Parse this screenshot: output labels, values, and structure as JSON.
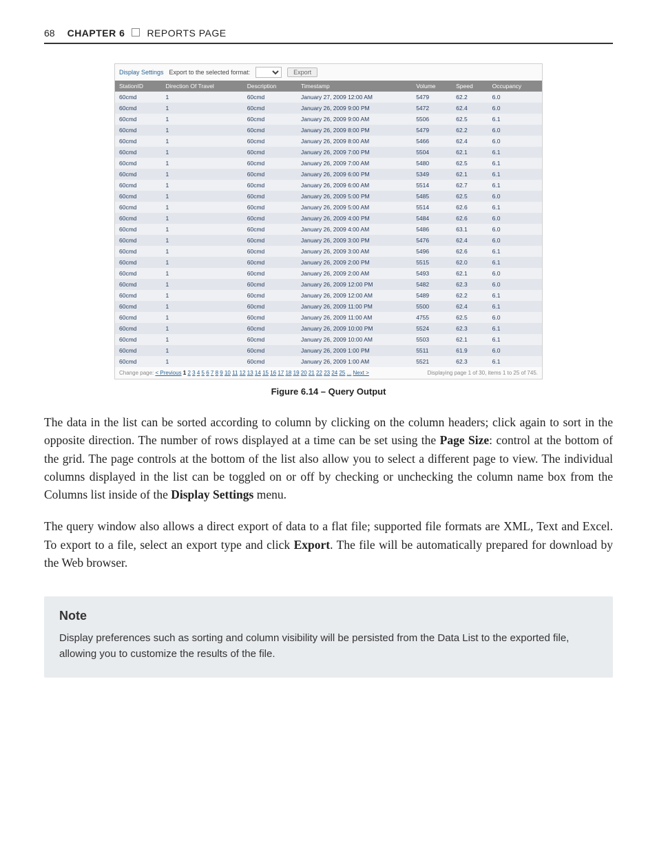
{
  "header": {
    "page_number": "68",
    "chapter_label": "CHAPTER 6",
    "chapter_title": "REPORTS PAGE"
  },
  "figure": {
    "toolbar": {
      "display_settings": "Display Settings",
      "export_label": "Export to the selected format:",
      "export_selected": " ",
      "export_button": "Export"
    },
    "columns": [
      "StationID",
      "Direction Of Travel",
      "Description",
      "Timestamp",
      "Volume",
      "Speed",
      "Occupancy"
    ],
    "rows": [
      [
        "60cmd",
        "1",
        "60cmd",
        "January 27, 2009 12:00 AM",
        "5479",
        "62.2",
        "6.0"
      ],
      [
        "60cmd",
        "1",
        "60cmd",
        "January 26, 2009 9:00 PM",
        "5472",
        "62.4",
        "6.0"
      ],
      [
        "60cmd",
        "1",
        "60cmd",
        "January 26, 2009 9:00 AM",
        "5506",
        "62.5",
        "6.1"
      ],
      [
        "60cmd",
        "1",
        "60cmd",
        "January 26, 2009 8:00 PM",
        "5479",
        "62.2",
        "6.0"
      ],
      [
        "60cmd",
        "1",
        "60cmd",
        "January 26, 2009 8:00 AM",
        "5466",
        "62.4",
        "6.0"
      ],
      [
        "60cmd",
        "1",
        "60cmd",
        "January 26, 2009 7:00 PM",
        "5504",
        "62.1",
        "6.1"
      ],
      [
        "60cmd",
        "1",
        "60cmd",
        "January 26, 2009 7:00 AM",
        "5480",
        "62.5",
        "6.1"
      ],
      [
        "60cmd",
        "1",
        "60cmd",
        "January 26, 2009 6:00 PM",
        "5349",
        "62.1",
        "6.1"
      ],
      [
        "60cmd",
        "1",
        "60cmd",
        "January 26, 2009 6:00 AM",
        "5514",
        "62.7",
        "6.1"
      ],
      [
        "60cmd",
        "1",
        "60cmd",
        "January 26, 2009 5:00 PM",
        "5485",
        "62.5",
        "6.0"
      ],
      [
        "60cmd",
        "1",
        "60cmd",
        "January 26, 2009 5:00 AM",
        "5514",
        "62.6",
        "6.1"
      ],
      [
        "60cmd",
        "1",
        "60cmd",
        "January 26, 2009 4:00 PM",
        "5484",
        "62.6",
        "6.0"
      ],
      [
        "60cmd",
        "1",
        "60cmd",
        "January 26, 2009 4:00 AM",
        "5486",
        "63.1",
        "6.0"
      ],
      [
        "60cmd",
        "1",
        "60cmd",
        "January 26, 2009 3:00 PM",
        "5476",
        "62.4",
        "6.0"
      ],
      [
        "60cmd",
        "1",
        "60cmd",
        "January 26, 2009 3:00 AM",
        "5496",
        "62.6",
        "6.1"
      ],
      [
        "60cmd",
        "1",
        "60cmd",
        "January 26, 2009 2:00 PM",
        "5515",
        "62.0",
        "6.1"
      ],
      [
        "60cmd",
        "1",
        "60cmd",
        "January 26, 2009 2:00 AM",
        "5493",
        "62.1",
        "6.0"
      ],
      [
        "60cmd",
        "1",
        "60cmd",
        "January 26, 2009 12:00 PM",
        "5482",
        "62.3",
        "6.0"
      ],
      [
        "60cmd",
        "1",
        "60cmd",
        "January 26, 2009 12:00 AM",
        "5489",
        "62.2",
        "6.1"
      ],
      [
        "60cmd",
        "1",
        "60cmd",
        "January 26, 2009 11:00 PM",
        "5500",
        "62.4",
        "6.1"
      ],
      [
        "60cmd",
        "1",
        "60cmd",
        "January 26, 2009 11:00 AM",
        "4755",
        "62.5",
        "6.0"
      ],
      [
        "60cmd",
        "1",
        "60cmd",
        "January 26, 2009 10:00 PM",
        "5524",
        "62.3",
        "6.1"
      ],
      [
        "60cmd",
        "1",
        "60cmd",
        "January 26, 2009 10:00 AM",
        "5503",
        "62.1",
        "6.1"
      ],
      [
        "60cmd",
        "1",
        "60cmd",
        "January 26, 2009 1:00 PM",
        "5511",
        "61.9",
        "6.0"
      ],
      [
        "60cmd",
        "1",
        "60cmd",
        "January 26, 2009 1:00 AM",
        "5521",
        "62.3",
        "6.1"
      ]
    ],
    "footer": {
      "change_page_label": "Change page:",
      "prev": "< Previous",
      "pages": [
        "1",
        "2",
        "3",
        "4",
        "5",
        "6",
        "7",
        "8",
        "9",
        "10",
        "11",
        "12",
        "13",
        "14",
        "15",
        "16",
        "17",
        "18",
        "19",
        "20",
        "21",
        "22",
        "23",
        "24",
        "25",
        "..."
      ],
      "next": "Next >",
      "display_info": "Displaying page 1 of 30, items 1 to 25 of 745."
    },
    "caption": "Figure 6.14 – Query Output"
  },
  "paragraphs": {
    "p1_a": "The data in the list can be sorted according to column by clicking on the column headers; click again to sort in the opposite direction. The number of rows displayed at a time can be set using the ",
    "p1_bold1": "Page Size",
    "p1_b": ": control at the bottom of the grid. The page controls at the bottom of the list also allow you to select a different page to view. The individual columns displayed in the list can be toggled on or off by checking or unchecking the column name box from the Columns list inside of the ",
    "p1_bold2": "Display Settings",
    "p1_c": " menu.",
    "p2_a": "The query window also allows a direct export of data to a flat file; supported file formats are XML, Text and Excel. To export to a file, select an export type and click ",
    "p2_bold": "Export",
    "p2_b": ". The file will be automatically prepared for download by the Web browser."
  },
  "note": {
    "title": "Note",
    "body": "Display preferences such as sorting and column visibility will be persisted from the Data List to the exported file, allowing you to customize the results of the file."
  }
}
